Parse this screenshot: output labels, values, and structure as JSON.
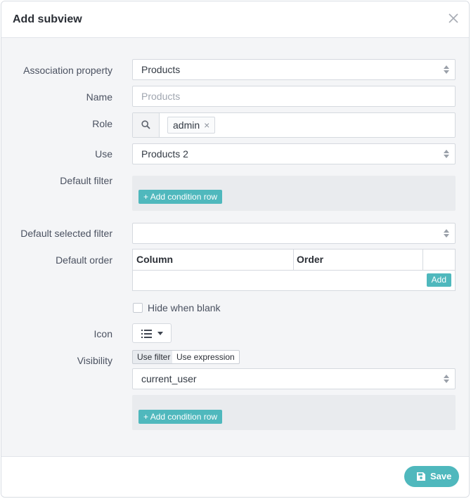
{
  "modal": {
    "title": "Add subview"
  },
  "labels": {
    "association_property": "Association property",
    "name": "Name",
    "role": "Role",
    "use": "Use",
    "default_filter": "Default filter",
    "default_selected_filter": "Default selected filter",
    "default_order": "Default order",
    "icon": "Icon",
    "visibility": "Visibility"
  },
  "fields": {
    "association_property": "Products",
    "name_placeholder": "Products",
    "role_tag": "admin",
    "role_tag_remove": "×",
    "use": "Products 2",
    "default_selected_filter": "",
    "visibility_value": "current_user"
  },
  "default_filter": {
    "add_condition": "Add condition row"
  },
  "default_order": {
    "columns": [
      "Column",
      "Order"
    ],
    "add": "Add"
  },
  "hide_when_blank": {
    "label": "Hide when blank",
    "checked": false
  },
  "visibility": {
    "use_filter": "Use filter",
    "use_expression": "Use expression",
    "add_condition": "Add condition row"
  },
  "footer": {
    "save": "Save"
  },
  "colors": {
    "accent": "#4fb8bd",
    "background": "#f4f5f7"
  }
}
